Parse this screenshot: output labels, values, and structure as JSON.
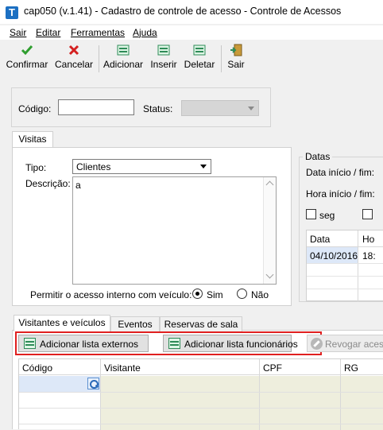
{
  "window": {
    "title": "cap050 (v.1.41) - Cadastro de controle de acesso - Controle de Acessos"
  },
  "menu": [
    "Sair",
    "Editar",
    "Ferramentas",
    "Ajuda"
  ],
  "toolbar": {
    "confirmar": "Confirmar",
    "cancelar": "Cancelar",
    "adicionar": "Adicionar",
    "inserir": "Inserir",
    "deletar": "Deletar",
    "sair": "Sair"
  },
  "header": {
    "codigo_label": "Código:",
    "codigo_value": "",
    "status_label": "Status:",
    "status_value": ""
  },
  "visitas": {
    "tab_label": "Visitas",
    "tipo_label": "Tipo:",
    "tipo_value": "Clientes",
    "descricao_label": "Descrição:",
    "descricao_value": "a",
    "permitir_label": "Permitir o acesso interno com veículo:",
    "sim_label": "Sim",
    "nao_label": "Não",
    "selected": "Sim"
  },
  "datas": {
    "title": "Datas",
    "data_inicio_fim": "Data início / fim:",
    "hora_inicio_fim": "Hora início / fim:",
    "seg_label": "seg",
    "grid_headers": [
      "Data",
      "Ho"
    ],
    "grid_rows": [
      [
        "04/10/2016",
        "18:"
      ]
    ]
  },
  "bottom_tabs": [
    "Visitantes e veículos",
    "Eventos",
    "Reservas de sala"
  ],
  "buttons": {
    "add_externos": "Adicionar lista externos",
    "add_funcionarios": "Adicionar lista funcionários",
    "revogar": "Revogar aces"
  },
  "grid": {
    "headers": [
      "Código",
      "Visitante",
      "CPF",
      "RG"
    ]
  },
  "colors": {
    "highlight": "#e02020",
    "accent": "#1b6fc2"
  }
}
